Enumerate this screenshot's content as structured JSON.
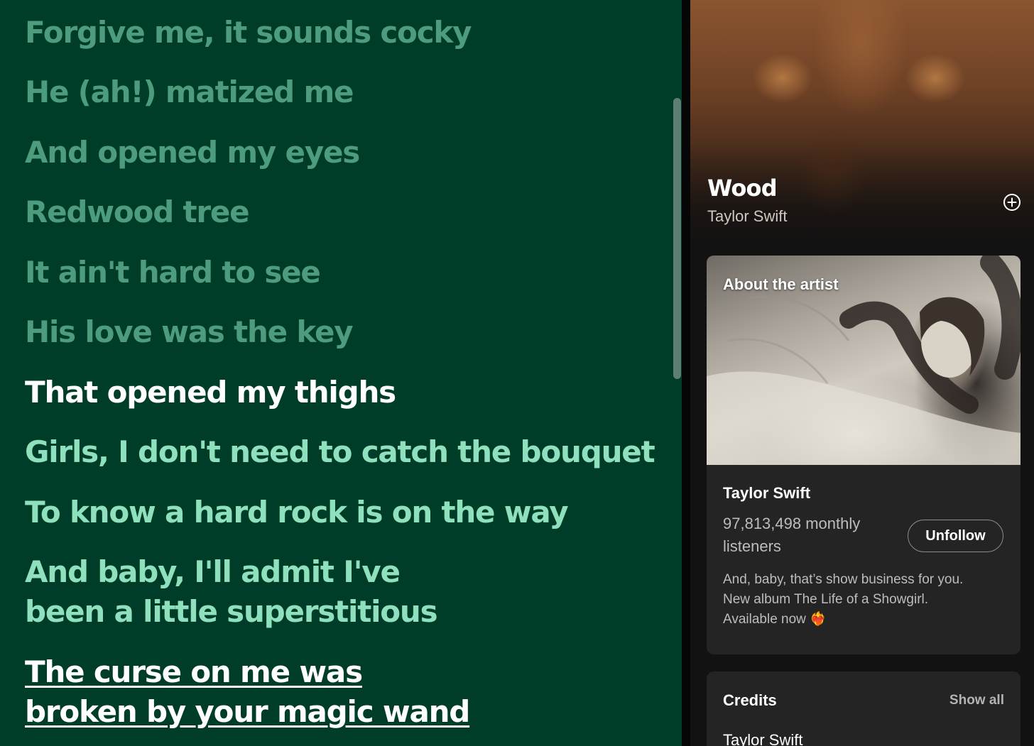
{
  "lyrics": {
    "lines": [
      {
        "text": "Forgive me, it sounds cocky",
        "state": "past"
      },
      {
        "text": "He (ah!) matized me",
        "state": "past"
      },
      {
        "text": "And opened my eyes",
        "state": "past"
      },
      {
        "text": "Redwood tree",
        "state": "past"
      },
      {
        "text": "It ain't hard to see",
        "state": "past"
      },
      {
        "text": "His love was the key",
        "state": "past"
      },
      {
        "text": "That opened my thighs",
        "state": "current"
      },
      {
        "text": "Girls, I don't need to catch the bouquet",
        "state": "upcoming"
      },
      {
        "text": "To know a hard rock is on the way",
        "state": "upcoming"
      },
      {
        "text_1": "And baby, I'll admit I've",
        "text_2": "been a little superstitious",
        "state": "upcoming"
      },
      {
        "text_1": "The curse on me was",
        "text_2": "broken by your magic wand",
        "state": "hovered"
      }
    ],
    "colors": {
      "background": "#003d28",
      "past": "#4c9c7d",
      "current": "#ffffff",
      "upcoming": "#8fe0bd"
    }
  },
  "now_playing": {
    "title": "Wood",
    "artist": "Taylor Swift",
    "add_icon": "plus-circle-icon"
  },
  "about_artist": {
    "label": "About the artist",
    "name": "Taylor Swift",
    "listeners": "97,813,498 monthly listeners",
    "follow_button": "Unfollow",
    "bio_line_1": "And, baby, that’s show business for you.",
    "bio_line_2": "New album The Life of a Showgirl.",
    "bio_line_3": "Available now",
    "bio_emoji": "❤️‍🔥"
  },
  "credits": {
    "title": "Credits",
    "show_all": "Show all",
    "first_credit": "Taylor Swift"
  }
}
